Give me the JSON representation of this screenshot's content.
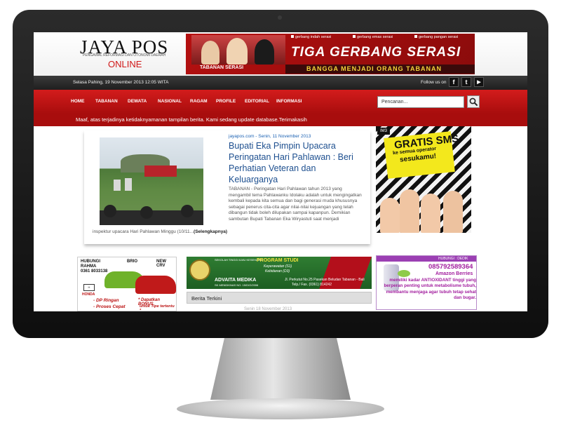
{
  "header": {
    "logo_title": "JAYA POS",
    "logo_tagline": "PENGAWAL REFORMASI DAN OTONOMI DAERAH",
    "logo_online": "ONLINE",
    "banner": {
      "tags": [
        "gerbang indah serasi",
        "gerbang emas serasi",
        "gerbang pangan serasi"
      ],
      "headline": "TIGA GERBANG SERASI",
      "photo_caption": "TABANAN SERASI",
      "slogan": "BANGGA MENJADI ORANG TABANAN"
    }
  },
  "datebar": {
    "date": "Selasa Pahing,  19 November 2013 12:05 WITA",
    "follow": "Follow us on",
    "social": [
      "f",
      "t",
      "▶"
    ]
  },
  "nav": {
    "items": [
      "HOME",
      "TABANAN",
      "DEWATA",
      "NASIONAL",
      "RAGAM",
      "PROFILE",
      "EDITORIAL",
      "INFORMASI"
    ],
    "search_placeholder": "Pencarian..."
  },
  "notice": "Maaf, atas terjadinya ketidaknyamanan tampilan berita. Kami sedang update database.Terimakasih",
  "featured": {
    "meta": "jayapos.com - Senin, 11 November 2013",
    "title": "Bupati Eka Pimpin Upacara Peringatan Hari Pahlawan : Beri Perhatian Veteran dan Keluarganya",
    "body": "TABANAN - Peringatan Hari Pahlawan tahun 2013 yang mengambil tema Pahlawanku Idolaku adalah untuk mengingatkan kembali kepada kita semua dan bagi generasi muda khususnya sebagai penerus cita-cita agar nilai-nilai kejuangan yang telah dibangun tidak boleh dilupakan sampai kapanpun.  Demikian sambutan Bupati Tabanan Eka Wiryastuti saat menjadi",
    "tail": "inspektur upacara Hari Pahlawan Minggu (10/11...",
    "more": "(Selengkapnya)"
  },
  "ads": {
    "sms": {
      "logo": "IM3",
      "line1": "GRATIS SMS",
      "line2": "ke semua operator",
      "line3": "sesukamu!"
    },
    "honda": {
      "line1": "HUBUNGI",
      "line2": "RAHMA",
      "line3": "0361 8033138",
      "brio": "BRIO",
      "crv": "NEW CRV",
      "honda": "HONDA",
      "promo1": "- DP Ringan",
      "promo2": "- Proses Cepat",
      "bonus1": "* Dapatkan BONUS",
      "bonus2": "untuk Tipe tertentu *"
    },
    "advaita": {
      "small": "SEKOLAH TINGGI ILMU KESEHATAN",
      "name": "ADVAITA MEDIKA",
      "sub": "SK MENDIKNAS NO. 15/D/O/2006",
      "program": "PROGRAM STUDI",
      "prog1": "Keperawatan (S1)",
      "prog2": "Kebidanan (D3)",
      "addr1": "Jl. Perkutut No.25 Pasekan  Beludan Tabanan - Bali",
      "addr2": "Telp./ Fax. (0361) 814242"
    },
    "amazon": {
      "hubungi": "HUBUNGI : DEDIK",
      "phone": "085792589364",
      "name": "Amazon Berries",
      "desc": "memiliki kadar ANTIOXIDANT tinggi yang berperan penting untuk metabolisme tubuh, membantu menjaga agar tubuh tetap sehat dan bugar."
    }
  },
  "section": {
    "berita_terkini": "Berita Terkini",
    "first_date": "Senin 18 November 2013"
  },
  "colors": {
    "nav_red": "#c01414",
    "link_blue": "#1d4f8f"
  }
}
